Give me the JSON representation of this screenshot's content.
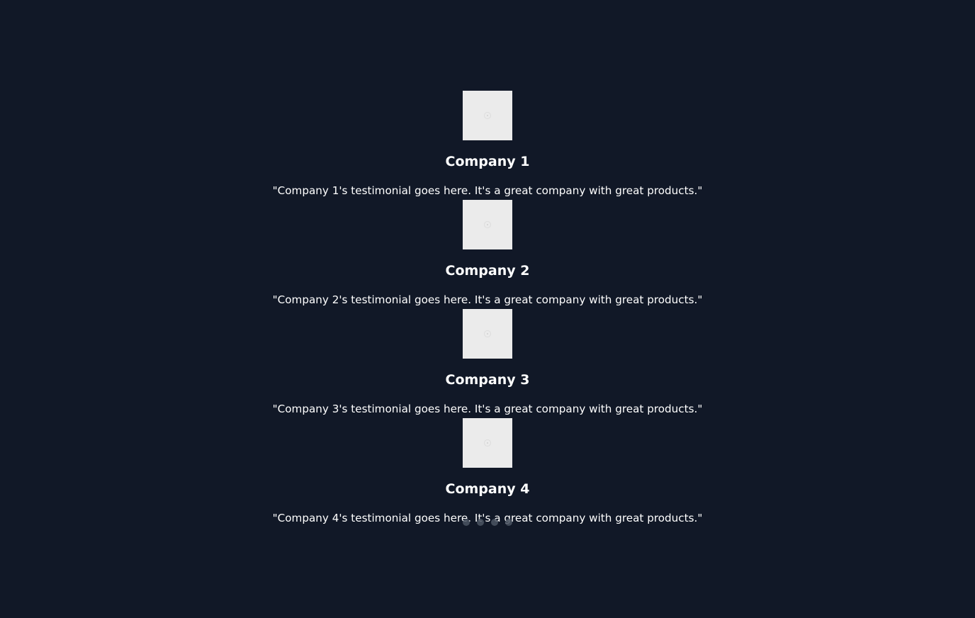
{
  "testimonials": [
    {
      "company": "Company 1",
      "quote": "\"Company 1's testimonial goes here. It's a great company with great products.\"",
      "logo_icon": "image-placeholder-icon"
    },
    {
      "company": "Company 2",
      "quote": "\"Company 2's testimonial goes here. It's a great company with great products.\"",
      "logo_icon": "image-placeholder-icon"
    },
    {
      "company": "Company 3",
      "quote": "\"Company 3's testimonial goes here. It's a great company with great products.\"",
      "logo_icon": "image-placeholder-icon"
    },
    {
      "company": "Company 4",
      "quote": "\"Company 4's testimonial goes here. It's a great company with great products.\"",
      "logo_icon": "image-placeholder-icon"
    }
  ],
  "carousel": {
    "dot_count": 4
  },
  "colors": {
    "background": "#111827",
    "text": "#ffffff",
    "logo_placeholder": "#ebebeb",
    "dot": "#4b5563"
  }
}
